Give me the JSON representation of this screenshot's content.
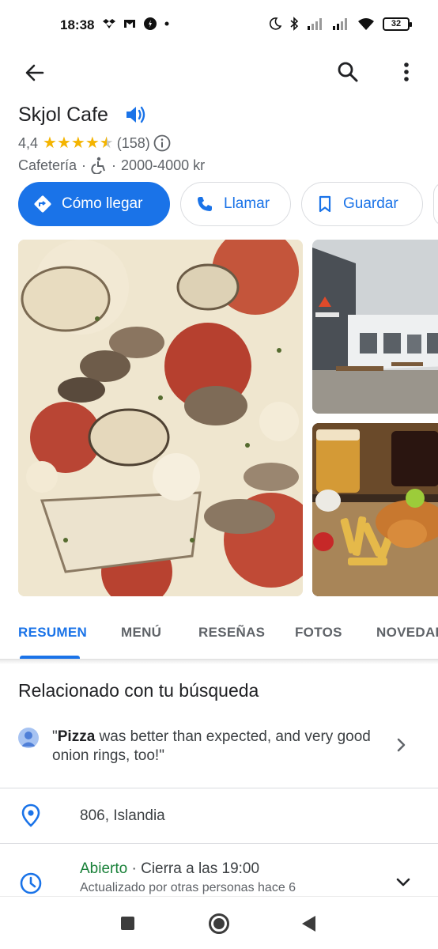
{
  "status_bar": {
    "time": "18:38",
    "left_icons": [
      "dropbox-icon",
      "gmail-icon",
      "app-icon",
      "dot-icon"
    ],
    "right_icons": [
      "moon-icon",
      "bluetooth-icon",
      "signal-icon",
      "signal-icon",
      "wifi-icon"
    ],
    "battery": "32"
  },
  "place": {
    "name": "Skjol Cafe",
    "rating": "4,4",
    "rating_value": 4.4,
    "review_count": "(158)",
    "category": "Cafetería",
    "separator": "·",
    "price_range": "2000-4000 kr"
  },
  "actions": {
    "directions": "Cómo llegar",
    "call": "Llamar",
    "save": "Guardar"
  },
  "tabs": {
    "summary": "RESUMEN",
    "menu": "MENÚ",
    "reviews": "RESEÑAS",
    "photos": "FOTOS",
    "updates": "NOVEDADES",
    "active": "summary"
  },
  "related": {
    "title": "Relacionado con tu búsqueda",
    "quote_open": "\"",
    "keyword": "Pizza",
    "review_rest": " was better than expected, and very good onion rings, too!\""
  },
  "address": {
    "text": "806, Islandia"
  },
  "hours": {
    "status": "Abierto",
    "separator": " · ",
    "closes": "Cierra a las 19:00",
    "updated": "Actualizado por otras personas hace 6"
  },
  "colors": {
    "accent": "#1a73e8",
    "star": "#f4b400",
    "open": "#188038"
  }
}
